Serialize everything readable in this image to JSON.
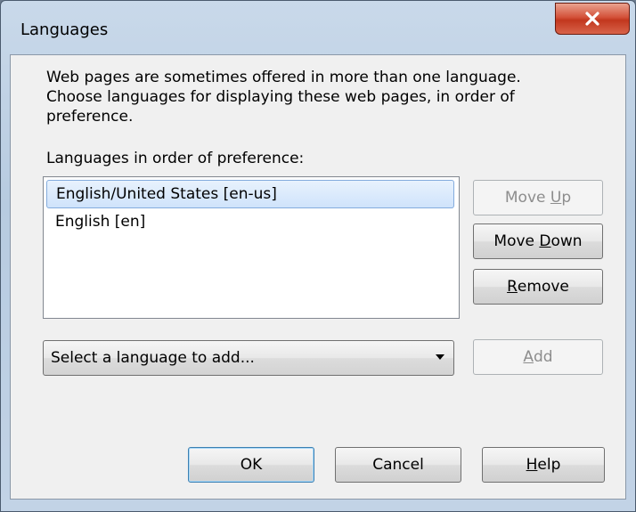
{
  "window": {
    "title": "Languages"
  },
  "description": {
    "line1": "Web pages are sometimes offered in more than one language.",
    "line2": "Choose languages for displaying these web pages, in order of",
    "line3": "preference."
  },
  "list": {
    "label": "Languages in order of preference:",
    "items": [
      {
        "label": "English/United States  [en-us]",
        "selected": true
      },
      {
        "label": "English  [en]",
        "selected": false
      }
    ]
  },
  "side_buttons": {
    "move_up": {
      "before": "Move ",
      "accel": "U",
      "after": "p",
      "enabled": false
    },
    "move_down": {
      "before": "Move ",
      "accel": "D",
      "after": "own",
      "enabled": true
    },
    "remove": {
      "before": "",
      "accel": "R",
      "after": "emove",
      "enabled": true
    }
  },
  "language_select": {
    "value": "Select a language to add..."
  },
  "add_button": {
    "before": "",
    "accel": "A",
    "after": "dd",
    "enabled": false
  },
  "footer": {
    "ok": "OK",
    "cancel": "Cancel",
    "help": {
      "before": "",
      "accel": "H",
      "after": "elp"
    }
  },
  "icons": {
    "close": "close-icon",
    "dropdown": "chevron-down-icon"
  },
  "colors": {
    "close_button": "#c2371e",
    "selection": "#cfe3fb",
    "disabled_text": "#8d8d8d"
  }
}
